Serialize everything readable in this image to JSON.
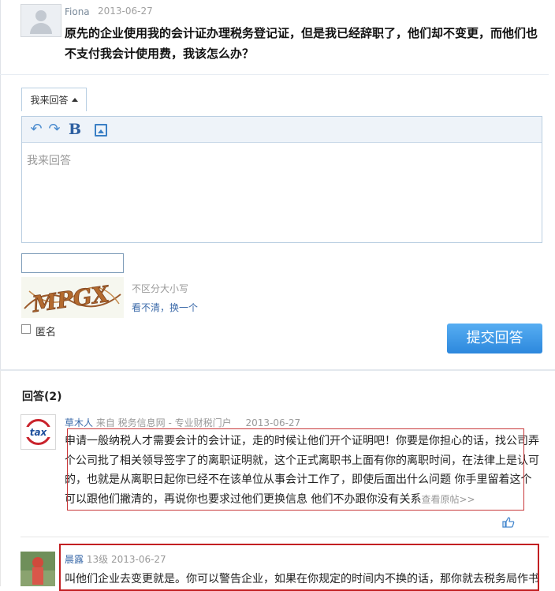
{
  "question": {
    "user": "Fiona",
    "date": "2013-06-27",
    "text": "原先的企业使用我的会计证办理税务登记证，但是我已经辞职了，他们却不变更，而他们也不支付我会计使用费，我该怎么办？"
  },
  "answer_form": {
    "tab_label": "我来回答",
    "placeholder": "我来回答",
    "toolbar": [
      "undo-icon",
      "redo-icon",
      "bold-icon",
      "image-icon"
    ],
    "captcha_text": "MPGX",
    "captcha_hint": "不区分大小写",
    "captcha_refresh": "看不清，换一个",
    "anonymous_label": "匿名",
    "submit_label": "提交回答"
  },
  "answers_title": "回答(2)",
  "answers": [
    {
      "user": "草木人",
      "source": "来自 税务信息网 - 专业财税门户",
      "date": "2013-06-27",
      "avatar_text": "tax",
      "text": "申请一般纳税人才需要会计的会计证，走的时候让他们开个证明吧！你要是你担心的话，找公司弄个公司批了相关领导签字了的离职证明就，这个正式离职书上面有你的离职时间，在法律上是认可的，也就是从离职日起你已经不在该单位从事会计工作了，即使后面出什么问题 你手里留着这个可以跟他们撇清的，再说你也要求过他们更换信息 他们不办跟你没有关系",
      "more": "查看原帖>>"
    },
    {
      "user": "晨露",
      "level": "13级",
      "date": "2013-06-27",
      "text": "叫他们企业去变更就是。你可以警告企业，如果在你规定的时间内不换的话，那你就去税务局作书"
    }
  ],
  "colors": {
    "accent": "#2c88dd",
    "link": "#3b6aa9",
    "highlight_box": "#c21f22"
  }
}
